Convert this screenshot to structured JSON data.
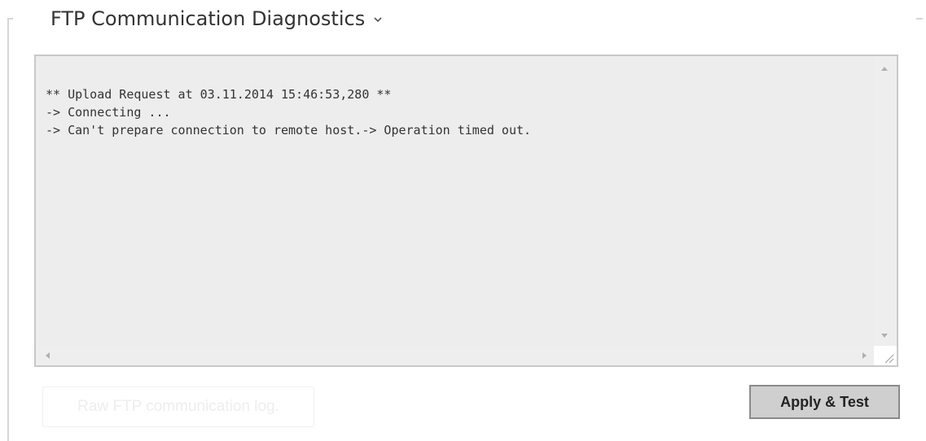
{
  "section": {
    "title": "FTP Communication Diagnostics"
  },
  "log": {
    "lines": [
      "** Upload Request at 03.11.2014 15:46:53,280 **",
      "-> Connecting ...",
      "-> Can't prepare connection to remote host.-> Operation timed out."
    ]
  },
  "buttons": {
    "raw_log_label": "Raw FTP communication log.",
    "apply_test_label": "Apply & Test"
  },
  "icons": {
    "title_chevron": "chevron-down-icon",
    "scroll_up": "arrow-up-icon",
    "scroll_down": "arrow-down-icon",
    "scroll_left": "arrow-left-icon",
    "scroll_right": "arrow-right-icon",
    "resize": "resize-grip-icon"
  },
  "colors": {
    "log_background": "#ededed",
    "button_background": "#cfcfcf",
    "button_border": "#8a8a8a"
  }
}
